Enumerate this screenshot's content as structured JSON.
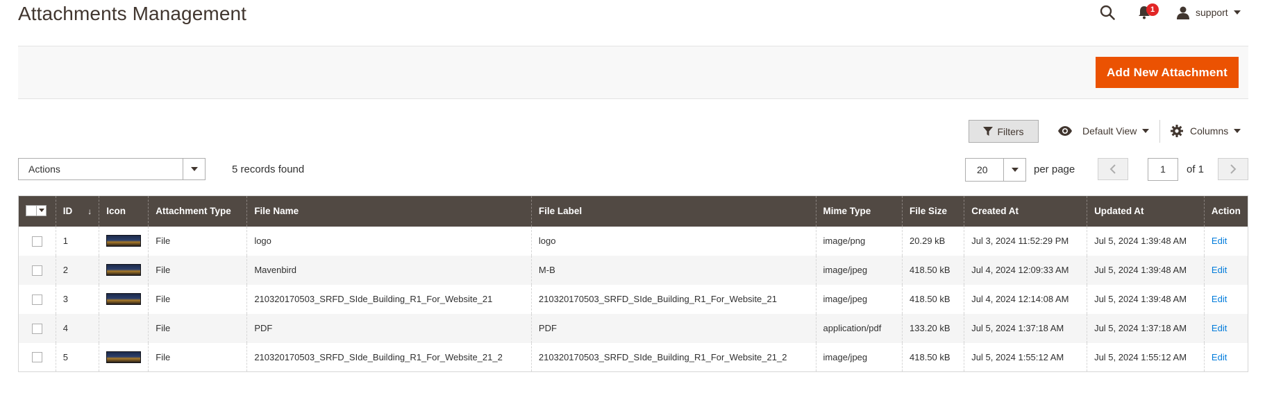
{
  "header": {
    "title": "Attachments Management",
    "notifications_count": "1",
    "user_name": "support"
  },
  "page_actions": {
    "add_button": "Add New Attachment"
  },
  "toolbar": {
    "filters_label": "Filters",
    "view_label": "Default View",
    "columns_label": "Columns",
    "actions_label": "Actions",
    "records_found": "5 records found",
    "per_page_value": "20",
    "per_page_label": "per page",
    "current_page": "1",
    "page_of": "of 1"
  },
  "colors": {
    "accent": "#eb5202",
    "header_bg": "#514943",
    "link": "#007bdb",
    "badge": "#e22626"
  },
  "grid": {
    "columns": [
      "ID",
      "Icon",
      "Attachment Type",
      "File Name",
      "File Label",
      "Mime Type",
      "File Size",
      "Created At",
      "Updated At",
      "Action"
    ],
    "rows": [
      {
        "id": "1",
        "has_icon": true,
        "type": "File",
        "file_name": "logo",
        "file_label": "logo",
        "mime": "image/png",
        "size": "20.29 kB",
        "created": "Jul 3, 2024 11:52:29 PM",
        "updated": "Jul 5, 2024 1:39:48 AM",
        "action": "Edit"
      },
      {
        "id": "2",
        "has_icon": true,
        "type": "File",
        "file_name": "Mavenbird",
        "file_label": "M-B",
        "mime": "image/jpeg",
        "size": "418.50 kB",
        "created": "Jul 4, 2024 12:09:33 AM",
        "updated": "Jul 5, 2024 1:39:48 AM",
        "action": "Edit"
      },
      {
        "id": "3",
        "has_icon": true,
        "type": "File",
        "file_name": "210320170503_SRFD_SIde_Building_R1_For_Website_21",
        "file_label": "210320170503_SRFD_SIde_Building_R1_For_Website_21",
        "mime": "image/jpeg",
        "size": "418.50 kB",
        "created": "Jul 4, 2024 12:14:08 AM",
        "updated": "Jul 5, 2024 1:39:48 AM",
        "action": "Edit"
      },
      {
        "id": "4",
        "has_icon": false,
        "type": "File",
        "file_name": "PDF",
        "file_label": "PDF",
        "mime": "application/pdf",
        "size": "133.20 kB",
        "created": "Jul 5, 2024 1:37:18 AM",
        "updated": "Jul 5, 2024 1:37:18 AM",
        "action": "Edit"
      },
      {
        "id": "5",
        "has_icon": true,
        "type": "File",
        "file_name": "210320170503_SRFD_SIde_Building_R1_For_Website_21_2",
        "file_label": "210320170503_SRFD_SIde_Building_R1_For_Website_21_2",
        "mime": "image/jpeg",
        "size": "418.50 kB",
        "created": "Jul 5, 2024 1:55:12 AM",
        "updated": "Jul 5, 2024 1:55:12 AM",
        "action": "Edit"
      }
    ]
  }
}
